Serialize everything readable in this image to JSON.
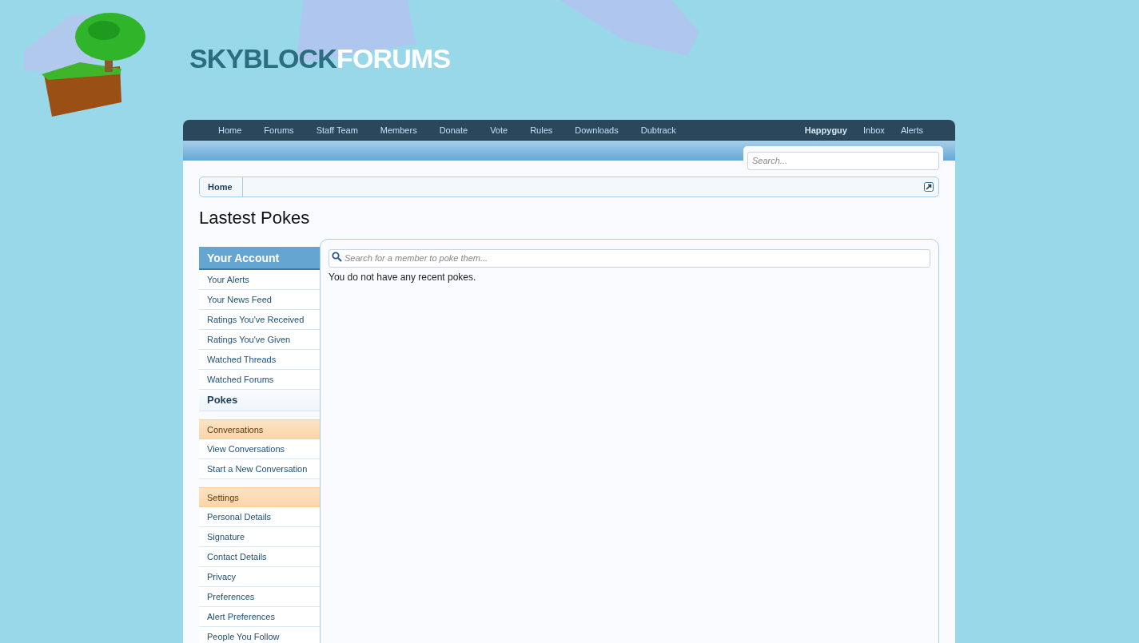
{
  "logo": {
    "part_1": "SKYBLOCK",
    "part_2": "FORUMS"
  },
  "nav": {
    "left": [
      {
        "label": "Home",
        "selected": false
      },
      {
        "label": "Forums",
        "selected": false
      },
      {
        "label": "Staff Team",
        "selected": false
      },
      {
        "label": "Members",
        "selected": false
      },
      {
        "label": "Donate",
        "selected": false
      },
      {
        "label": "Vote",
        "selected": false
      },
      {
        "label": "Rules",
        "selected": false
      },
      {
        "label": "Downloads",
        "selected": false
      },
      {
        "label": "Dubtrack",
        "selected": false
      }
    ],
    "right": [
      "Happyguy",
      "Inbox",
      "Alerts"
    ]
  },
  "search": {
    "placeholder": "Search..."
  },
  "breadcrumb": [
    "Home"
  ],
  "page_title": "Lastest Pokes",
  "sidebar": [
    {
      "title": "Your Account",
      "kind": "primary",
      "items": [
        {
          "label": "Your Alerts",
          "selected": false
        },
        {
          "label": "Your News Feed",
          "selected": false
        },
        {
          "label": "Ratings You've Received",
          "selected": false
        },
        {
          "label": "Ratings You've Given",
          "selected": false
        },
        {
          "label": "Watched Threads",
          "selected": false
        },
        {
          "label": "Watched Forums",
          "selected": false
        },
        {
          "label": "Pokes",
          "selected": true
        }
      ]
    },
    {
      "title": "Conversations",
      "kind": "secondary",
      "items": [
        {
          "label": "View Conversations",
          "selected": false
        },
        {
          "label": "Start a New Conversation",
          "selected": false
        }
      ]
    },
    {
      "title": "Settings",
      "kind": "secondary",
      "items": [
        {
          "label": "Personal Details",
          "selected": false
        },
        {
          "label": "Signature",
          "selected": false
        },
        {
          "label": "Contact Details",
          "selected": false
        },
        {
          "label": "Privacy",
          "selected": false
        },
        {
          "label": "Preferences",
          "selected": false
        },
        {
          "label": "Alert Preferences",
          "selected": false
        },
        {
          "label": "People You Follow",
          "selected": false
        }
      ]
    }
  ],
  "main": {
    "member_search": {
      "placeholder": "Search for a member to poke them..."
    },
    "message": "You do not have any recent pokes."
  }
}
